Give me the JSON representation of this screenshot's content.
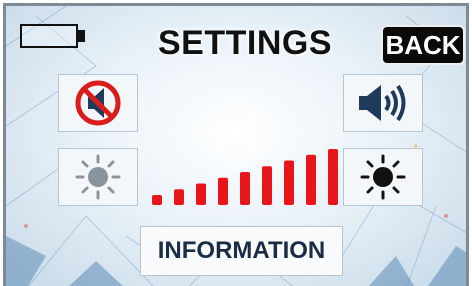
{
  "header": {
    "title": "SETTINGS",
    "back_label": "BACK"
  },
  "battery": {
    "icon": "battery-empty-icon"
  },
  "controls": {
    "mute_icon": "speaker-muted-icon",
    "volume_icon": "speaker-volume-icon",
    "brightness_down_icon": "sun-dim-icon",
    "brightness_up_icon": "sun-bright-icon"
  },
  "brightness_level": {
    "filled": 9,
    "total": 9,
    "color": "#e8161b"
  },
  "footer": {
    "info_label": "INFORMATION"
  },
  "colors": {
    "back_bg": "#0a0a0a",
    "info_text": "#1a2c46",
    "mute_red": "#d91c1c",
    "speaker_navy": "#1f3a5a"
  }
}
